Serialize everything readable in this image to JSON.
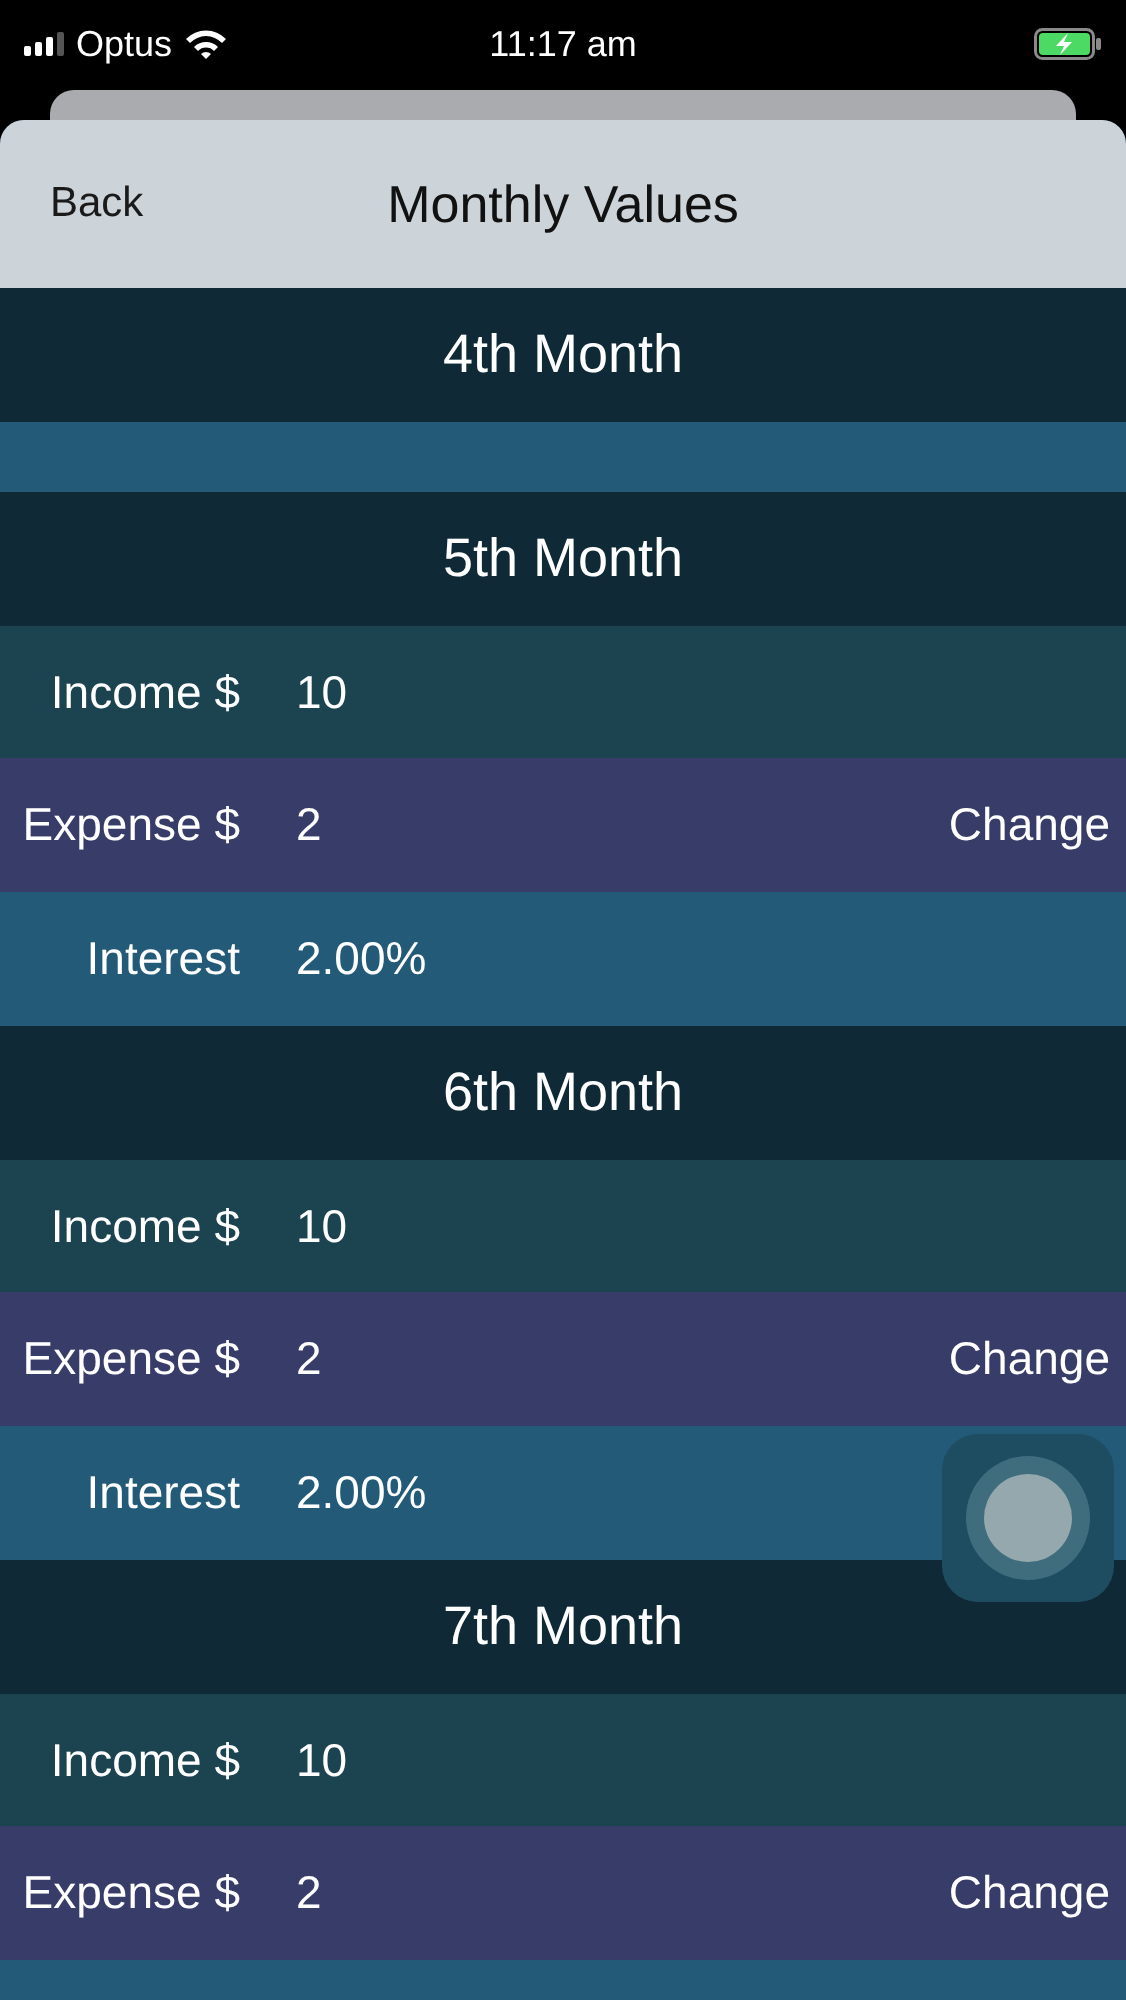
{
  "status_bar": {
    "carrier": "Optus",
    "time": "11:17 am"
  },
  "nav": {
    "back": "Back",
    "title": "Monthly Values"
  },
  "months": [
    {
      "title": "4th Month",
      "rows": [
        {
          "kind": "interest",
          "clipped": true
        }
      ]
    },
    {
      "title": "5th Month",
      "rows": [
        {
          "kind": "income",
          "label": "Income $",
          "value": "10",
          "clipped": false
        },
        {
          "kind": "expense",
          "label": "Expense $",
          "value": "2",
          "action": "Change",
          "clipped": false
        },
        {
          "kind": "interest",
          "label": "Interest",
          "value": "2.00%",
          "clipped": false
        }
      ]
    },
    {
      "title": "6th Month",
      "rows": [
        {
          "kind": "income",
          "label": "Income $",
          "value": "10",
          "clipped": false
        },
        {
          "kind": "expense",
          "label": "Expense $",
          "value": "2",
          "action": "Change",
          "clipped": false
        },
        {
          "kind": "interest",
          "label": "Interest",
          "value": "2.00%",
          "clipped": false
        }
      ]
    },
    {
      "title": "7th Month",
      "rows": [
        {
          "kind": "income",
          "label": "Income $",
          "value": "10",
          "clipped": false
        },
        {
          "kind": "expense",
          "label": "Expense $",
          "value": "2",
          "action": "Change",
          "clipped": false
        }
      ]
    }
  ]
}
